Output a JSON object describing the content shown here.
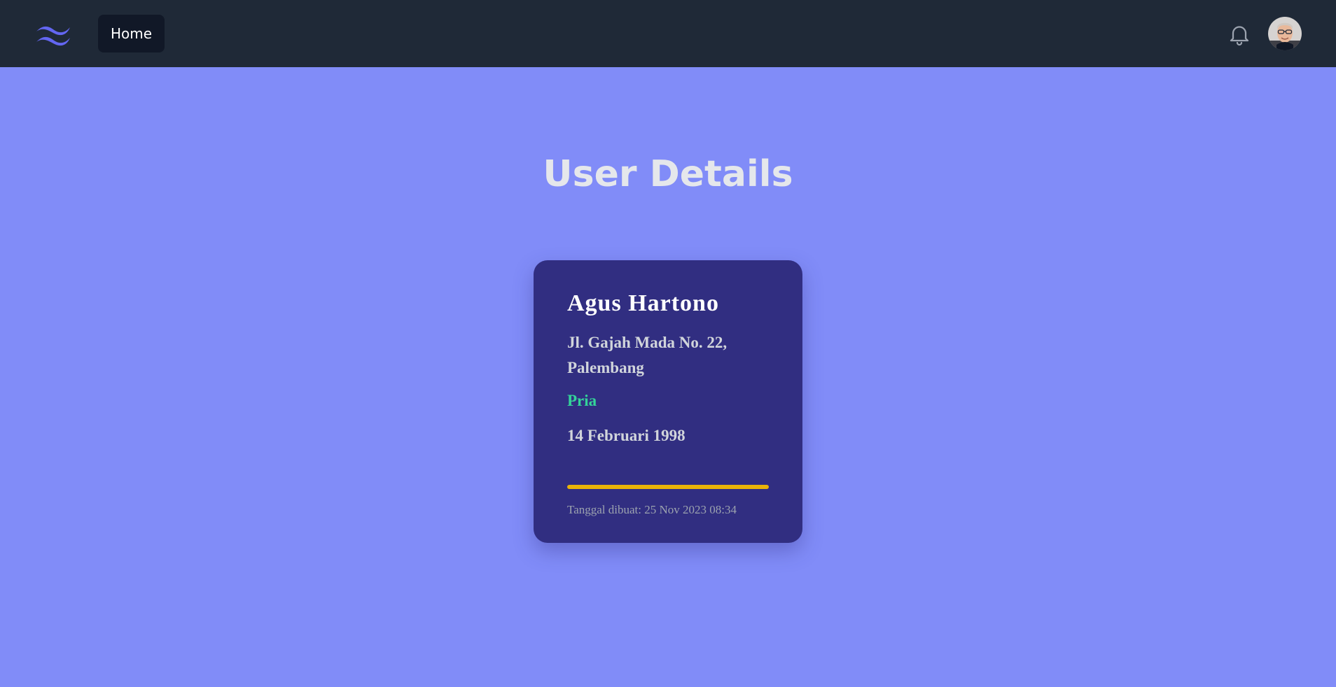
{
  "navbar": {
    "logo_icon": "tailwind-logo-icon",
    "home_label": "Home",
    "notification_icon": "bell-icon",
    "avatar_icon": "user-avatar"
  },
  "main": {
    "title": "User Details"
  },
  "user": {
    "name": "Agus Hartono",
    "address": "Jl. Gajah Mada No. 22, Palembang",
    "gender": "Pria",
    "birthdate": "14 Februari 1998",
    "created_at": "Tanggal dibuat: 25 Nov 2023 08:34"
  },
  "colors": {
    "navbar_bg": "#1f2937",
    "page_bg": "#818cf8",
    "card_bg": "#312e81",
    "accent_gender": "#34d399",
    "divider": "#eab308",
    "logo": "#6366f1"
  }
}
